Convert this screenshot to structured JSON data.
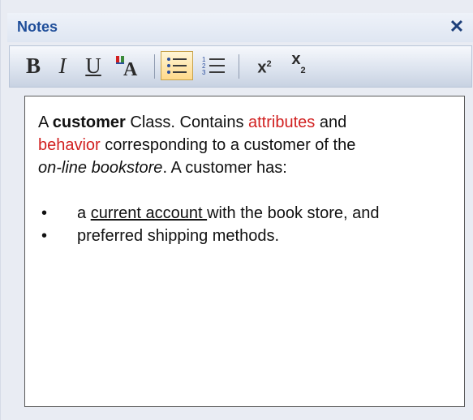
{
  "window": {
    "title": "Notes",
    "close_glyph": "✕"
  },
  "toolbar": {
    "bold": "B",
    "italic": "I",
    "underline": "U",
    "font_color_icon": "font-color-icon",
    "bullets_icon": "bullet-list-icon",
    "numbering_icon": "numbered-list-icon",
    "superscript_base": "x",
    "superscript_mark": "2",
    "subscript_base": "x",
    "subscript_mark": "2"
  },
  "note": {
    "p_text_1": "A ",
    "p_bold": "customer",
    "p_text_2": " Class. Contains ",
    "p_red_1": "attributes",
    "p_text_3": " and ",
    "p_red_2": "behavior",
    "p_text_4": " corresponding to a customer of the ",
    "p_italic": "on-line bookstore",
    "p_text_5": ". A customer has:",
    "bullet_glyph": "•",
    "item1_before": "a ",
    "item1_underlined": "current account ",
    "item1_after": "with the book store, and",
    "item2": "preferred shipping methods."
  },
  "colors": {
    "accent_red": "#d11f1f",
    "title_blue": "#1f4e9a"
  }
}
